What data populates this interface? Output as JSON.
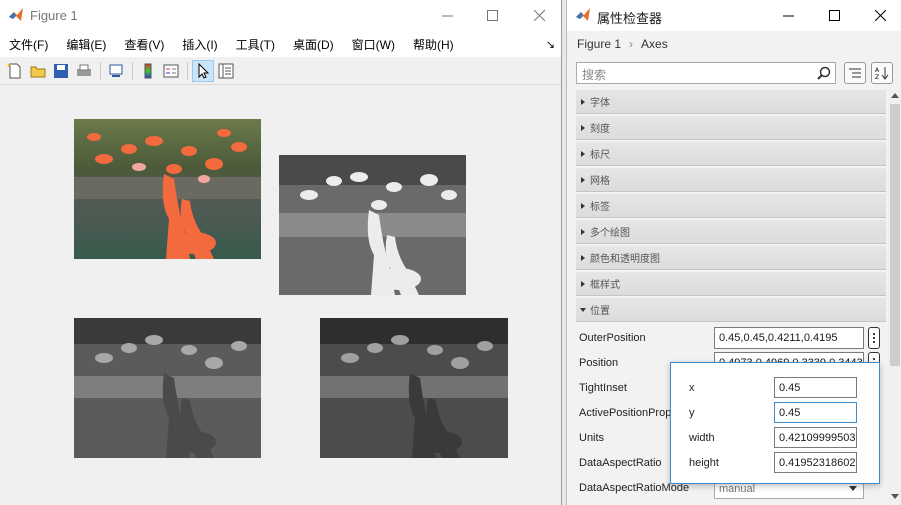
{
  "figure": {
    "title": "Figure 1",
    "menu": [
      "文件(F)",
      "编辑(E)",
      "查看(V)",
      "插入(I)",
      "工具(T)",
      "桌面(D)",
      "窗口(W)",
      "帮助(H)"
    ],
    "menu_arrow": "↘",
    "toolbar_icons": [
      "new-figure-icon",
      "open-file-icon",
      "save-icon",
      "print-icon",
      "link-plot-icon",
      "colorbar-icon",
      "legend-icon",
      "edit-plot-icon",
      "property-inspector-icon"
    ]
  },
  "inspector": {
    "title": "属性检查器",
    "breadcrumb": [
      "Figure 1",
      "Axes"
    ],
    "breadcrumb_sep": "›",
    "search_placeholder": "搜索",
    "sections": [
      "字体",
      "刻度",
      "标尺",
      "网格",
      "标签",
      "多个绘图",
      "颜色和透明度图",
      "框样式",
      "位置"
    ],
    "properties": [
      {
        "label": "OuterPosition",
        "value": "0.45,0.45,0.4211,0.4195"
      },
      {
        "label": "Position",
        "value": "0.4973,0.4969,0.3339,0.3443"
      },
      {
        "label": "TightInset",
        "value": ""
      },
      {
        "label": "ActivePositionProperty",
        "value": ""
      },
      {
        "label": "Units",
        "value": ""
      },
      {
        "label": "DataAspectRatio",
        "value": ""
      },
      {
        "label": "DataAspectRatioMode",
        "value": "manual"
      }
    ],
    "popup": {
      "fields": [
        {
          "label": "x",
          "value": "0.45"
        },
        {
          "label": "y",
          "value": "0.45"
        },
        {
          "label": "width",
          "value": "0.42109999503"
        },
        {
          "label": "height",
          "value": "0.41952318602"
        }
      ]
    }
  },
  "colors": {
    "accent": "#3c8ccf",
    "flamingo": "#f26a3d"
  }
}
